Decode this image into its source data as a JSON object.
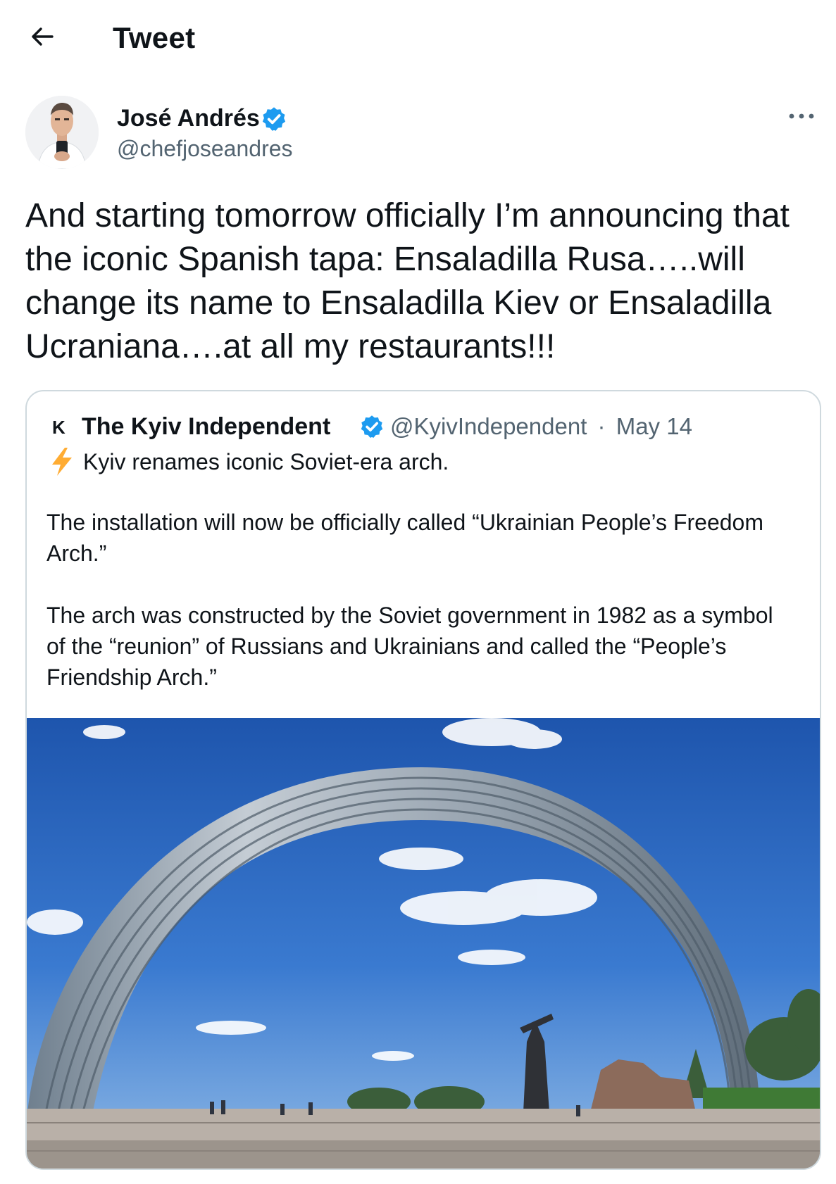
{
  "header": {
    "title": "Tweet",
    "back_icon": "arrow-left-icon"
  },
  "tweet": {
    "author_name": "José Andrés",
    "author_handle": "@chefjoseandres",
    "verified": true,
    "text": "And starting tomorrow officially I’m announcing that the iconic Spanish tapa: Ensaladilla Rusa…..will change its name to Ensaladilla Kiev or Ensaladilla Ucraniana….at all my restaurants!!!",
    "more_icon": "more-horizontal-icon"
  },
  "quoted_tweet": {
    "logo_letter": "K",
    "author_name": "The Kyiv Independent",
    "verified": true,
    "handle": "@KyivIndependent",
    "separator": "·",
    "date": "May 14",
    "headline_icon": "lightning-bolt-icon",
    "headline": "Kyiv renames iconic Soviet-era arch.",
    "paragraph_1": "The installation will now be officially called “Ukrainian People’s Freedom Arch.”",
    "paragraph_2": "The arch was constructed by the Soviet government in 1982 as a symbol of the “reunion” of Russians and Ukrainians and called the “People’s Friendship Arch.”"
  },
  "colors": {
    "verified_blue": "#1d9bf0",
    "text_primary": "#0f1419",
    "text_secondary": "#536471",
    "border": "#cfd9de",
    "bolt_yellow": "#ffac33"
  }
}
